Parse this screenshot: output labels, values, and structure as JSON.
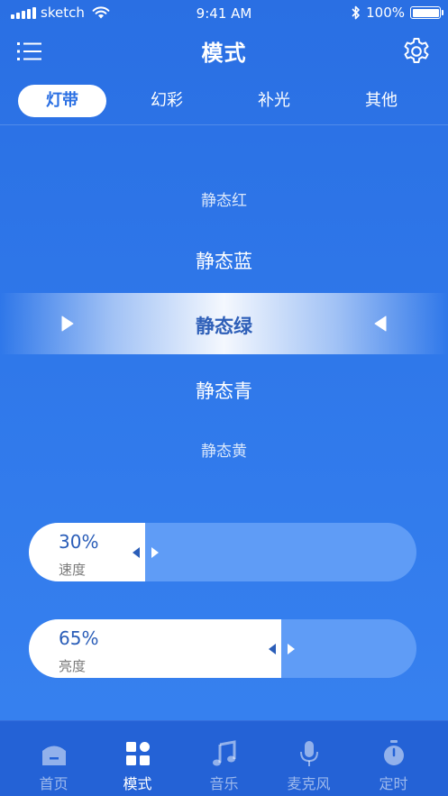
{
  "status_bar": {
    "carrier": "sketch",
    "time": "9:41 AM",
    "battery": "100%"
  },
  "header": {
    "title": "模式",
    "menu_icon": "list-menu-icon",
    "settings_icon": "gear-icon"
  },
  "tabs": [
    {
      "label": "灯带",
      "active": true
    },
    {
      "label": "幻彩",
      "active": false
    },
    {
      "label": "补光",
      "active": false
    },
    {
      "label": "其他",
      "active": false
    }
  ],
  "picker": {
    "items": [
      "静态红",
      "静态蓝",
      "静态绿",
      "静态青",
      "静态黄"
    ],
    "selected_index": 2
  },
  "sliders": [
    {
      "value": "30%",
      "label": "速度",
      "level": 0.3
    },
    {
      "value": "65%",
      "label": "亮度",
      "level": 0.65
    }
  ],
  "bottom_nav": [
    {
      "label": "首页",
      "icon": "home-icon",
      "active": false
    },
    {
      "label": "模式",
      "icon": "grid-mode-icon",
      "active": true
    },
    {
      "label": "音乐",
      "icon": "music-note-icon",
      "active": false
    },
    {
      "label": "麦克风",
      "icon": "microphone-icon",
      "active": false
    },
    {
      "label": "定时",
      "icon": "stopwatch-icon",
      "active": false
    }
  ],
  "colors": {
    "background": "#2f76e6",
    "active_tab_text": "#2a6fe3",
    "selected_item_text": "#2e5fb8",
    "slider_track": "#5f9cf6",
    "nav_background": "#2462d6"
  }
}
